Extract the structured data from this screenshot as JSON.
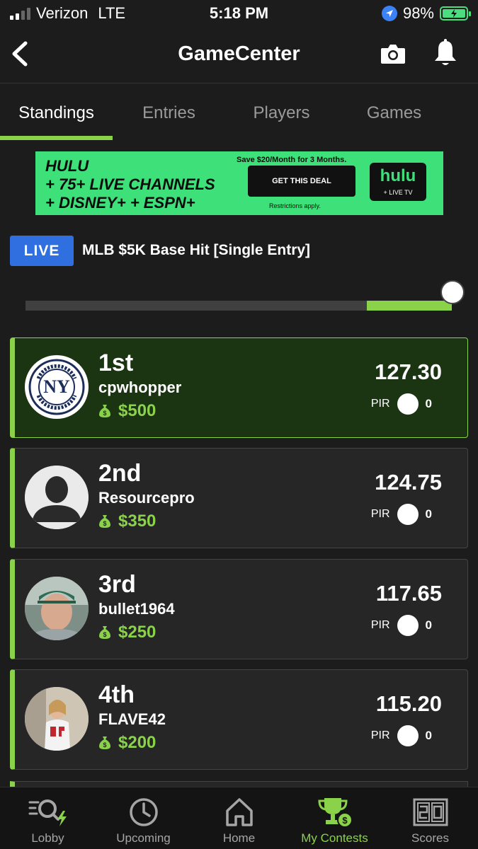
{
  "status_bar": {
    "carrier": "Verizon",
    "network": "LTE",
    "time": "5:18 PM",
    "battery": "98%"
  },
  "nav": {
    "title": "GameCenter"
  },
  "tabs": [
    {
      "label": "Standings",
      "active": true
    },
    {
      "label": "Entries",
      "active": false
    },
    {
      "label": "Players",
      "active": false
    },
    {
      "label": "Games",
      "active": false
    }
  ],
  "ad": {
    "line1": "HULU",
    "line2": "+ 75+ LIVE CHANNELS",
    "line3": "+ DISNEY+ + ESPN+",
    "offer": "Save $20/Month for 3 Months.",
    "cta": "GET THIS DEAL",
    "fine_print": "Restrictions apply.",
    "logo": "hulu",
    "logo_sub": "+ LIVE TV"
  },
  "contest": {
    "badge": "LIVE",
    "title": "MLB $5K Base Hit [Single Entry]",
    "progress_fraction": 0.8
  },
  "standings": [
    {
      "rank": "1st",
      "user": "cpwhopper",
      "prize": "$500",
      "score": "127.30",
      "pir_label": "PIR",
      "pir": "0",
      "avatar": "yankees-logo"
    },
    {
      "rank": "2nd",
      "user": "Resourcepro",
      "prize": "$350",
      "score": "124.75",
      "pir_label": "PIR",
      "pir": "0",
      "avatar": "default-silhouette"
    },
    {
      "rank": "3rd",
      "user": "bullet1964",
      "prize": "$250",
      "score": "117.65",
      "pir_label": "PIR",
      "pir": "0",
      "avatar": "photo"
    },
    {
      "rank": "4th",
      "user": "FLAVE42",
      "prize": "$200",
      "score": "115.20",
      "pir_label": "PIR",
      "pir": "0",
      "avatar": "photo"
    }
  ],
  "tabbar": [
    {
      "label": "Lobby",
      "icon": "lobby-icon",
      "active": false
    },
    {
      "label": "Upcoming",
      "icon": "clock-icon",
      "active": false
    },
    {
      "label": "Home",
      "icon": "home-icon",
      "active": false
    },
    {
      "label": "My Contests",
      "icon": "trophy-icon",
      "active": true
    },
    {
      "label": "Scores",
      "icon": "scoreboard-icon",
      "active": false
    }
  ],
  "colors": {
    "accent": "#8ad24a",
    "live": "#2f6fdf",
    "background": "#1c1c1c",
    "card": "#262626",
    "highlight_card": "#1b3513"
  }
}
